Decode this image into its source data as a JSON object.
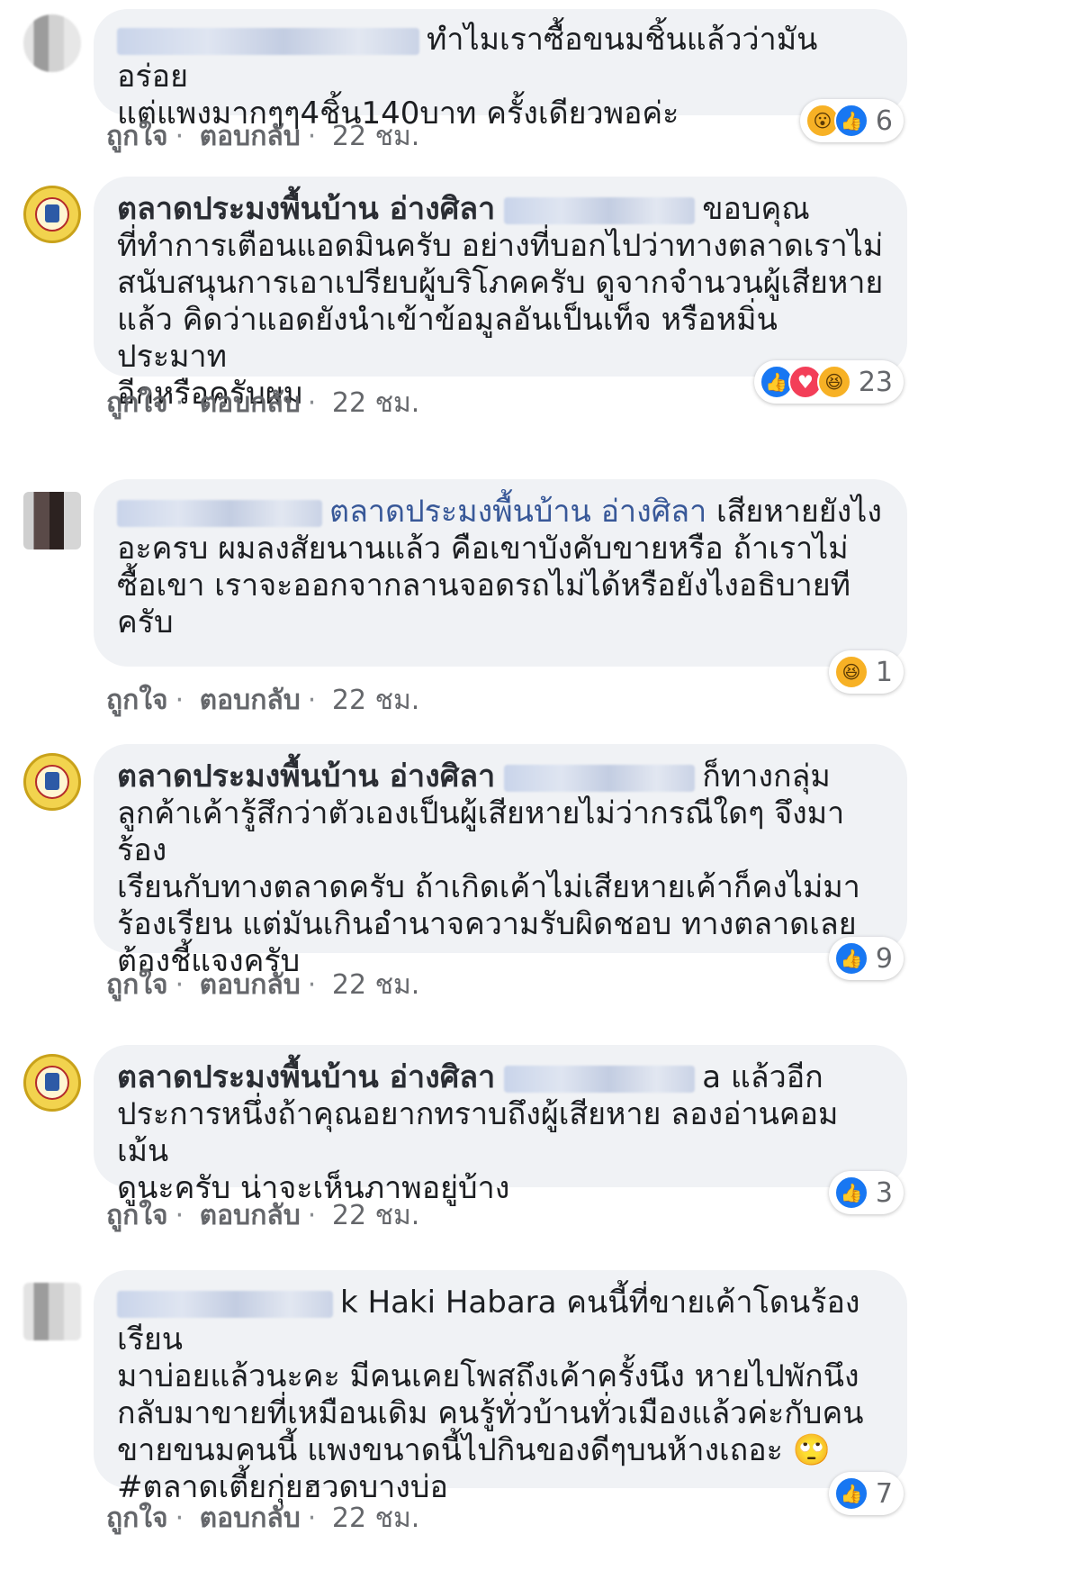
{
  "comments": [
    {
      "text": "ทำไมเราซื้อขนมชิ้นแล้วว่ามันอร่อย\nแต่แพงมากๆๆ4ชิ้น140บาท ครั้งเดียวพอค่ะ",
      "reaction_count": "6",
      "reaction_icons": [
        "wow-icon",
        "like-icon"
      ],
      "actions": {
        "like": "ถูกใจ",
        "reply": "ตอบกลับ",
        "time": "22 ชม."
      }
    },
    {
      "author": "ตลาดประมงพื้นบ้าน อ่างศิลา",
      "text": "ขอบคุณ\nที่ทำการเตือนแอดมินครับ อย่างที่บอกไปว่าทางตลาดเราไม่\nสนับสนุนการเอาเปรียบผู้บริโภคครับ ดูจากจำนวนผู้เสียหาย\nแล้ว คิดว่าแอดยังนำเข้าข้อมูลอันเป็นเท็จ หรือหมิ่นประมาท\nอีกหรือครับผม",
      "reaction_count": "23",
      "reaction_icons": [
        "like-icon",
        "love-icon",
        "haha-icon"
      ],
      "actions": {
        "like": "ถูกใจ",
        "reply": "ตอบกลับ",
        "time": "22 ชม."
      }
    },
    {
      "mention": "ตลาดประมงพื้นบ้าน อ่างศิลา",
      "text": " เสียหายยังไง\nอะครบ ผมลงสัยนานแล้ว คือเขาบังคับขายหรือ ถ้าเราไม่\nซื้อเขา เราจะออกจากลานจอดรถไม่ได้หรือยังไงอธิบายที\nครับ",
      "reaction_count": "1",
      "reaction_icons": [
        "haha-icon"
      ],
      "actions": {
        "like": "ถูกใจ",
        "reply": "ตอบกลับ",
        "time": "22 ชม."
      }
    },
    {
      "author": "ตลาดประมงพื้นบ้าน อ่างศิลา",
      "text": "ก็ทางกลุ่ม\nลูกค้าเค้ารู้สึกว่าตัวเองเป็นผู้เสียหายไม่ว่ากรณีใดๆ จึงมาร้อง\nเรียนกับทางตลาดครับ ถ้าเกิดเค้าไม่เสียหายเค้าก็คงไม่มา\nร้องเรียน แต่มันเกินอำนาจความรับผิดชอบ ทางตลาดเลย\nต้องชี้แจงครับ",
      "reaction_count": "9",
      "reaction_icons": [
        "like-icon"
      ],
      "actions": {
        "like": "ถูกใจ",
        "reply": "ตอบกลับ",
        "time": "22 ชม."
      }
    },
    {
      "author": "ตลาดประมงพื้นบ้าน อ่างศิลา",
      "text": "a แล้วอีก\nประการหนึ่งถ้าคุณอยากทราบถึงผู้เสียหาย ลองอ่านคอมเม้น\nดูนะครับ น่าจะเห็นภาพอยู่บ้าง",
      "reaction_count": "3",
      "reaction_icons": [
        "like-icon"
      ],
      "actions": {
        "like": "ถูกใจ",
        "reply": "ตอบกลับ",
        "time": "22 ชม."
      }
    },
    {
      "text": "k Haki Habara คนนี้ที่ขายเค้าโดนร้องเรียน\nมาบ่อยแล้วนะคะ มีคนเคยโพสถึงเค้าครั้งนึง หายไปพักนึง\nกลับมาขายที่เหมือนเดิม คนรู้ทั่วบ้านทั่วเมืองแล้วค่ะกับคน\nขายขนมคนนี้ แพงขนาดนี้ไปกินของดีๆบนห้างเถอะ 🙄\n#ตลาดเตี้ยกุ่ยฮวดบางบ่อ",
      "reaction_count": "7",
      "reaction_icons": [
        "like-icon"
      ],
      "actions": {
        "like": "ถูกใจ",
        "reply": "ตอบกลับ",
        "time": "22 ชม."
      }
    }
  ]
}
